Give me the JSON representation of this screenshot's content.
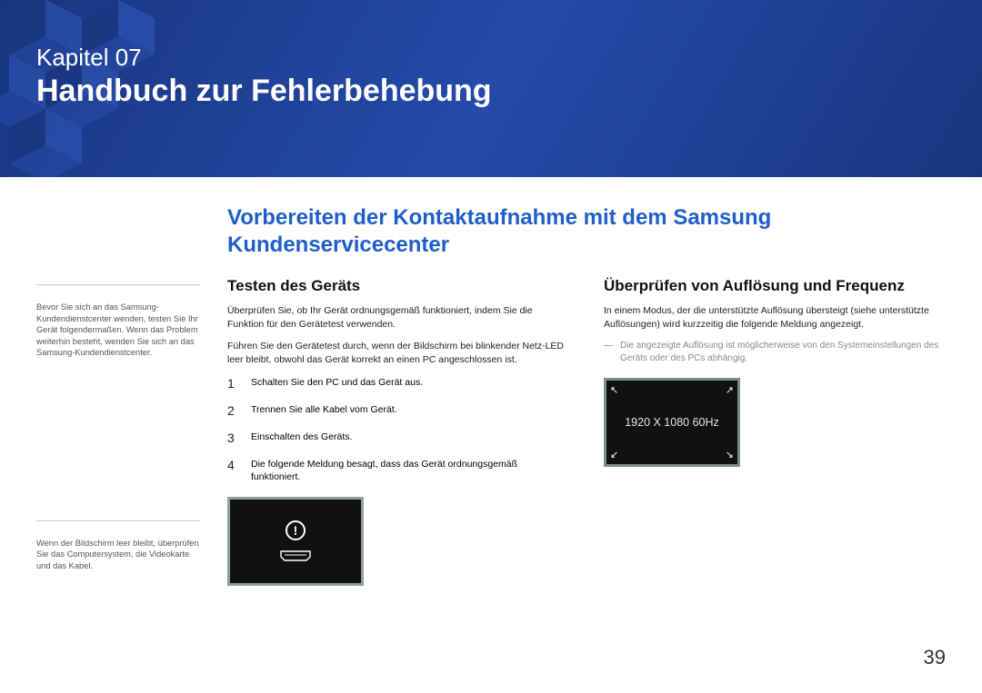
{
  "chapter": {
    "label": "Kapitel 07",
    "title": "Handbuch zur Fehlerbehebung"
  },
  "section_title": "Vorbereiten der Kontaktaufnahme mit dem Samsung Kundenservicecenter",
  "sidebar": {
    "note1": "Bevor Sie sich an das Samsung-Kundendienstcenter wenden, testen Sie Ihr Gerät folgendermaßen. Wenn das Problem weiterhin besteht, wenden Sie sich an das Samsung-Kundendienstcenter.",
    "note2": "Wenn der Bildschirm leer bleibt, überprüfen Sie das Computersystem, die Videokarte und das Kabel."
  },
  "left_col": {
    "heading": "Testen des Geräts",
    "p1": "Überprüfen Sie, ob Ihr Gerät ordnungsgemäß funktioniert, indem Sie die Funktion für den Gerätetest verwenden.",
    "p2": "Führen Sie den Gerätetest durch, wenn der Bildschirm bei blinkender Netz-LED leer bleibt, obwohl das Gerät korrekt an einen PC angeschlossen ist.",
    "steps": [
      "Schalten Sie den PC und das Gerät aus.",
      "Trennen Sie alle Kabel vom Gerät.",
      "Einschalten des Geräts.",
      "Die folgende Meldung besagt, dass das Gerät ordnungsgemäß funktioniert."
    ]
  },
  "right_col": {
    "heading": "Überprüfen von Auflösung und Frequenz",
    "p1": "In einem Modus, der die unterstützte Auflösung übersteigt (siehe unterstützte Auflösungen) wird kurzzeitig die folgende Meldung angezeigt.",
    "note": "Die angezeigte Auflösung ist möglicherweise von den Systemeinstellungen des Geräts oder des PCs abhängig.",
    "resolution_text": "1920 X 1080 60Hz"
  },
  "page_number": "39"
}
